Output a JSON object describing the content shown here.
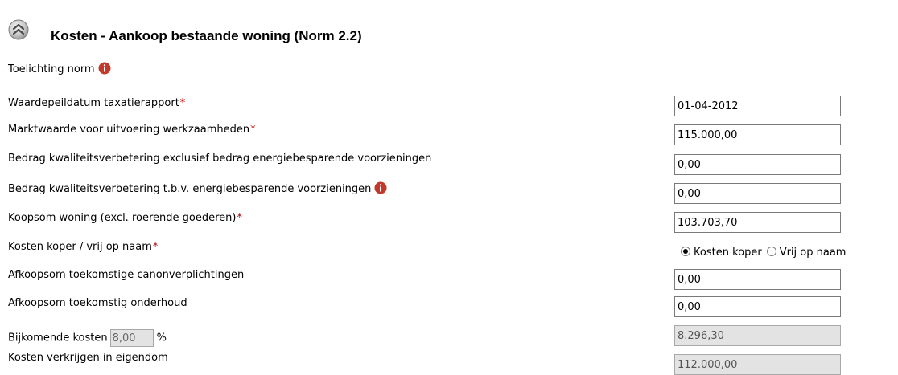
{
  "section": {
    "title": "Kosten - Aankoop bestaande woning (Norm 2.2)",
    "collapse_icon": "double-chevron-up-icon"
  },
  "toelichting": {
    "label": "Toelichting norm",
    "icon": "info-icon"
  },
  "fields": {
    "waardepeildatum": {
      "label": "Waardepeildatum taxatierapport",
      "required_mark": "*",
      "value": "01-04-2012"
    },
    "marktwaarde": {
      "label": "Marktwaarde voor uitvoering werkzaamheden",
      "required_mark": "*",
      "value": "115.000,00"
    },
    "kwaliteit_excl": {
      "label": "Bedrag kwaliteitsverbetering exclusief bedrag energiebesparende voorzieningen",
      "value": "0,00"
    },
    "kwaliteit_energie": {
      "label": "Bedrag kwaliteitsverbetering t.b.v. energiebesparende voorzieningen",
      "value": "0,00"
    },
    "koopsom": {
      "label": "Koopsom woning (excl. roerende goederen)",
      "required_mark": "*",
      "value": "103.703,70"
    },
    "kosten_koper": {
      "label": "Kosten koper / vrij op naam",
      "required_mark": "*",
      "options": [
        "Kosten koper",
        "Vrij op naam"
      ],
      "selected": "Kosten koper"
    },
    "afkoopsom_canon": {
      "label": "Afkoopsom toekomstige canonverplichtingen",
      "value": "0,00"
    },
    "afkoopsom_onderhoud": {
      "label": "Afkoopsom toekomstig onderhoud",
      "value": "0,00"
    },
    "bijkomende_kosten": {
      "label": "Bijkomende kosten",
      "percentage": "8,00",
      "unit": "%",
      "value": "8.296,30"
    },
    "kosten_verkrijgen": {
      "label": "Kosten verkrijgen in eigendom",
      "value": "112.000,00"
    }
  },
  "colors": {
    "required": "#c00000",
    "info_icon": "#c0392b",
    "readonly_bg": "#e3e3e3",
    "divider": "#c8c8c8"
  }
}
